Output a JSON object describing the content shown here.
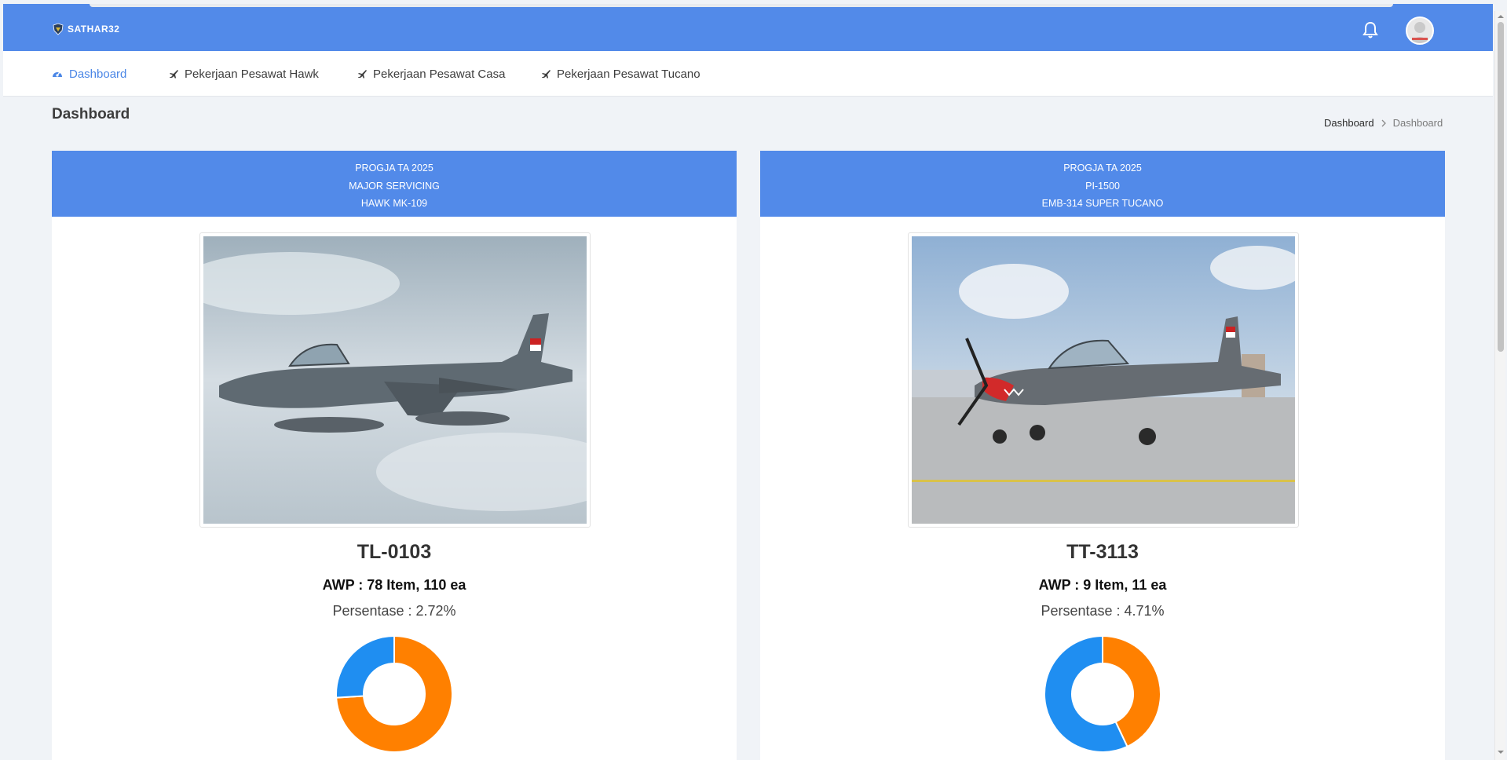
{
  "app": {
    "brand": "SATHAR32"
  },
  "header": {
    "notifications_icon": "bell-icon",
    "avatar_icon": "user-avatar"
  },
  "nav": [
    {
      "label": "Dashboard",
      "icon": "dashboard-gauge-icon",
      "active": true
    },
    {
      "label": "Pekerjaan Pesawat Hawk",
      "icon": "plane-icon",
      "active": false
    },
    {
      "label": "Pekerjaan Pesawat Casa",
      "icon": "plane-icon",
      "active": false
    },
    {
      "label": "Pekerjaan Pesawat Tucano",
      "icon": "plane-icon",
      "active": false
    }
  ],
  "page": {
    "title": "Dashboard"
  },
  "breadcrumb": {
    "home": "Dashboard",
    "current": "Dashboard"
  },
  "cards": [
    {
      "header": [
        "PROGJA TA 2025",
        "MAJOR SERVICING",
        "HAWK MK-109"
      ],
      "image": "hawk-jet-photo",
      "registration": "TL-0103",
      "awp": "AWP : 78 Item, 110 ea",
      "percent_text": "Persentase : 2.72%",
      "donut": {
        "blue": 0.26,
        "orange": 0.74
      }
    },
    {
      "header": [
        "PROGJA TA 2025",
        "PI-1500",
        "EMB-314 SUPER TUCANO"
      ],
      "image": "tucano-aircraft-photo",
      "registration": "TT-3113",
      "awp": "AWP : 9 Item, 11 ea",
      "percent_text": "Persentase : 4.71%",
      "donut": {
        "blue": 0.57,
        "orange": 0.43
      }
    }
  ],
  "colors": {
    "primary": "#528ae9",
    "donut_blue": "#1f8ef1",
    "donut_orange": "#ff8000"
  }
}
